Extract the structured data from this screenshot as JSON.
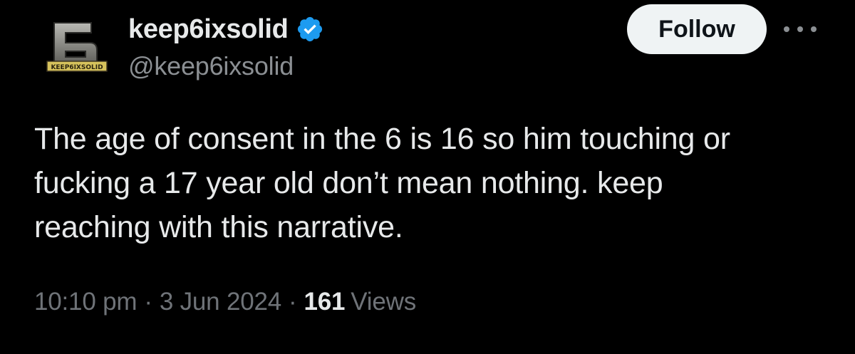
{
  "author": {
    "display_name": "keep6ixsolid",
    "handle": "@keep6ixsolid",
    "verified": true,
    "avatar_logo_text": "KEEP6IXSOLID",
    "avatar_glyph": "6"
  },
  "actions": {
    "follow_label": "Follow",
    "more_icon": "more-horizontal-icon"
  },
  "tweet": {
    "text": "The age of consent in the 6 is 16 so him touching or\nfucking a 17 year old don’t mean nothing. keep\nreaching with this narrative."
  },
  "meta": {
    "time": "10:10 pm",
    "separator": "·",
    "date": "3 Jun 2024",
    "views_count": "161",
    "views_label": "Views"
  },
  "colors": {
    "background": "#000000",
    "text_primary": "#e7e9ea",
    "text_secondary": "#8b8f93",
    "verified_badge": "#1d9bf0",
    "follow_bg": "#eff3f4"
  }
}
